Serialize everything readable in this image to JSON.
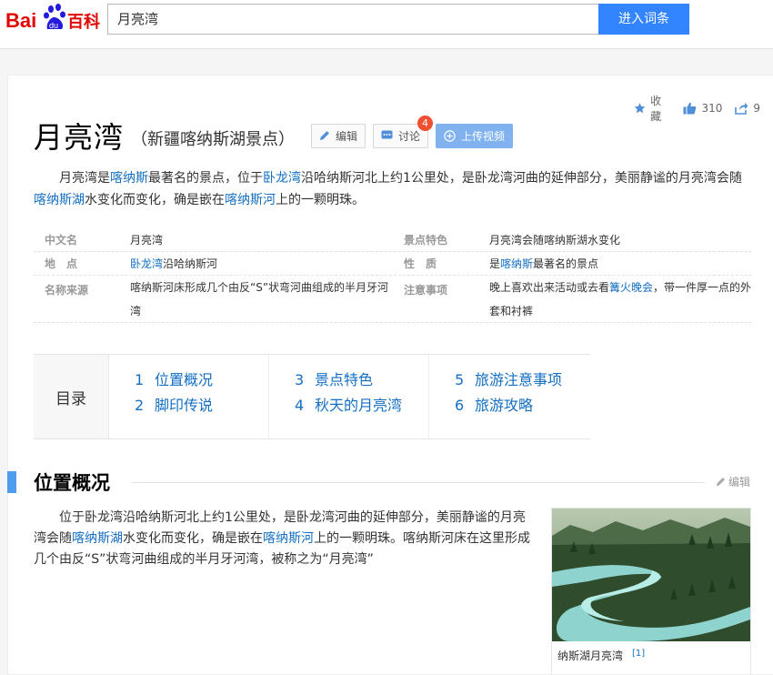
{
  "header": {
    "logo_text": "Bai百科",
    "search_value": "月亮湾",
    "search_button": "进入词条"
  },
  "stats": {
    "favorite_label": "收藏",
    "likes": "310",
    "shares": "9"
  },
  "entry": {
    "title": "月亮湾",
    "subtitle": "（新疆喀纳斯湖景点）",
    "edit_button": "编辑",
    "discuss_button": "讨论",
    "discuss_badge": "4",
    "upload_button": "上传视频"
  },
  "summary": {
    "p1": "月亮湾是",
    "l1": "喀纳斯",
    "p2": "最著名的景点，位于",
    "l2": "卧龙湾",
    "p3": "沿哈纳斯河北上约1公里处，是卧龙湾河曲的延伸部分，美丽静谧的月亮湾会随",
    "l3": "喀纳斯湖",
    "p4": "水变化而变化，确是嵌在",
    "l4": "喀纳斯河",
    "p5": "上的一颗明珠。"
  },
  "info": {
    "k_name": "中文名",
    "v_name": "月亮湾",
    "k_feature": "景点特色",
    "v_feature": "月亮湾会随喀纳斯湖水变化",
    "k_location": "地　点",
    "v_location_link": "卧龙湾",
    "v_location_rest": "沿哈纳斯河",
    "k_nature": "性　质",
    "v_nature_pre": "是",
    "v_nature_link": "喀纳斯",
    "v_nature_rest": "最著名的景点",
    "k_origin": "名称来源",
    "v_origin": "喀纳斯河床形成几个由反“S”状弯河曲组成的半月牙河湾",
    "k_notice": "注意事项",
    "v_notice_pre": "晚上喜欢出来活动或去看",
    "v_notice_link": "篝火晚会",
    "v_notice_rest": "，带一件厚一点的外套和衬裤"
  },
  "toc": {
    "title": "目录",
    "items": [
      {
        "n": "1",
        "label": "位置概况"
      },
      {
        "n": "2",
        "label": "脚印传说"
      },
      {
        "n": "3",
        "label": "景点特色"
      },
      {
        "n": "4",
        "label": "秋天的月亮湾"
      },
      {
        "n": "5",
        "label": "旅游注意事项"
      },
      {
        "n": "6",
        "label": "旅游攻略"
      }
    ]
  },
  "section": {
    "title": "位置概况",
    "edit": "编辑",
    "p1": "位于卧龙湾沿哈纳斯河北上约1公里处，是卧龙湾河曲的延伸部分，美丽静谧的月亮湾会随",
    "l1": "喀纳斯湖",
    "p2": "水变化而变化，确是嵌在",
    "l2": "喀纳斯河",
    "p3": "上的一颗明珠。喀纳斯河床在这里形成几个由反“S”状弯河曲组成的半月牙河湾，被称之为“月亮湾”"
  },
  "image": {
    "caption": "纳斯湖月亮湾",
    "ref": "[1]"
  },
  "colors": {
    "accent": "#3385ff",
    "link": "#136ec2",
    "section_bar": "#4f9cee",
    "badge": "#f0502f"
  }
}
